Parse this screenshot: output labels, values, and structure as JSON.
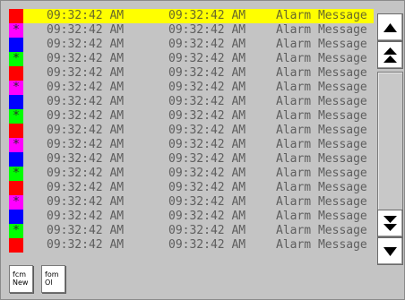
{
  "alarms": {
    "rows": [
      {
        "color": "#ff0000",
        "star": false,
        "time1": "09:32:42 AM",
        "time2": "09:32:42 AM",
        "message": "Alarm Message",
        "selected": true
      },
      {
        "color": "#ff00ff",
        "star": true,
        "time1": "09:32:42 AM",
        "time2": "09:32:42 AM",
        "message": "Alarm Message",
        "selected": false
      },
      {
        "color": "#0000ff",
        "star": false,
        "time1": "09:32:42 AM",
        "time2": "09:32:42 AM",
        "message": "Alarm Message",
        "selected": false
      },
      {
        "color": "#00ff00",
        "star": true,
        "time1": "09:32:42 AM",
        "time2": "09:32:42 AM",
        "message": "Alarm Message",
        "selected": false
      },
      {
        "color": "#ff0000",
        "star": false,
        "time1": "09:32:42 AM",
        "time2": "09:32:42 AM",
        "message": "Alarm Message",
        "selected": false
      },
      {
        "color": "#ff00ff",
        "star": true,
        "time1": "09:32:42 AM",
        "time2": "09:32:42 AM",
        "message": "Alarm Message",
        "selected": false
      },
      {
        "color": "#0000ff",
        "star": false,
        "time1": "09:32:42 AM",
        "time2": "09:32:42 AM",
        "message": "Alarm Message",
        "selected": false
      },
      {
        "color": "#00ff00",
        "star": true,
        "time1": "09:32:42 AM",
        "time2": "09:32:42 AM",
        "message": "Alarm Message",
        "selected": false
      },
      {
        "color": "#ff0000",
        "star": false,
        "time1": "09:32:42 AM",
        "time2": "09:32:42 AM",
        "message": "Alarm Message",
        "selected": false
      },
      {
        "color": "#ff00ff",
        "star": true,
        "time1": "09:32:42 AM",
        "time2": "09:32:42 AM",
        "message": "Alarm Message",
        "selected": false
      },
      {
        "color": "#0000ff",
        "star": false,
        "time1": "09:32:42 AM",
        "time2": "09:32:42 AM",
        "message": "Alarm Message",
        "selected": false
      },
      {
        "color": "#00ff00",
        "star": true,
        "time1": "09:32:42 AM",
        "time2": "09:32:42 AM",
        "message": "Alarm Message",
        "selected": false
      },
      {
        "color": "#ff0000",
        "star": false,
        "time1": "09:32:42 AM",
        "time2": "09:32:42 AM",
        "message": "Alarm Message",
        "selected": false
      },
      {
        "color": "#ff00ff",
        "star": true,
        "time1": "09:32:42 AM",
        "time2": "09:32:42 AM",
        "message": "Alarm Message",
        "selected": false
      },
      {
        "color": "#0000ff",
        "star": false,
        "time1": "09:32:42 AM",
        "time2": "09:32:42 AM",
        "message": "Alarm Message",
        "selected": false
      },
      {
        "color": "#00ff00",
        "star": true,
        "time1": "09:32:42 AM",
        "time2": "09:32:42 AM",
        "message": "Alarm Message",
        "selected": false
      },
      {
        "color": "#ff0000",
        "star": false,
        "time1": "09:32:42 AM",
        "time2": "09:32:42 AM",
        "message": "Alarm Message",
        "selected": false
      }
    ]
  },
  "scrollbar": {
    "up_icon": "triangle-up",
    "page_up_icon": "double-triangle-up",
    "page_down_icon": "double-triangle-down",
    "down_icon": "triangle-down"
  },
  "footer": {
    "first_new": {
      "line1": "fcm",
      "line2": "New"
    },
    "first_old": {
      "line1": "fom",
      "line2": "Ol"
    }
  },
  "colors": {
    "selection": "#ffff00",
    "background": "#c4c4c4"
  }
}
